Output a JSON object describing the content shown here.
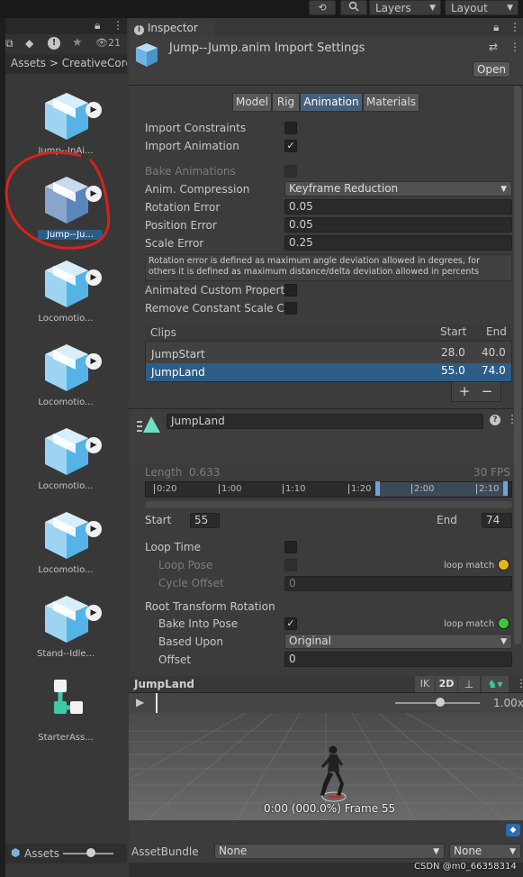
{
  "topbar": {
    "layers_label": "Layers",
    "layout_label": "Layout"
  },
  "project": {
    "toolbar_count": "21",
    "breadcrumb": "Assets > CreativeCore",
    "assets": [
      {
        "label": "Jump--InAi...",
        "selected": false
      },
      {
        "label": "Jump--Ju...",
        "selected": true
      },
      {
        "label": "Locomotio...",
        "selected": false
      },
      {
        "label": "Locomotio...",
        "selected": false
      },
      {
        "label": "Locomotio...",
        "selected": false
      },
      {
        "label": "Locomotio...",
        "selected": false
      },
      {
        "label": "Stand--Idle...",
        "selected": false
      },
      {
        "label": "StarterAss...",
        "selected": false
      }
    ],
    "footer_label": "Assets"
  },
  "inspector": {
    "tab_label": "Inspector",
    "title": "Jump--Jump.anim Import Settings",
    "open_label": "Open",
    "tabs": [
      "Model",
      "Rig",
      "Animation",
      "Materials"
    ],
    "import_constraints_label": "Import Constraints",
    "import_animation_label": "Import Animation",
    "bake_animations_label": "Bake Animations",
    "anim_compression_label": "Anim. Compression",
    "anim_compression_value": "Keyframe Reduction",
    "rotation_error_label": "Rotation Error",
    "rotation_error_value": "0.05",
    "position_error_label": "Position Error",
    "position_error_value": "0.05",
    "scale_error_label": "Scale Error",
    "scale_error_value": "0.25",
    "help_text": "Rotation error is defined as maximum angle deviation allowed in degrees, for others it is defined as maximum distance/delta deviation allowed in percents",
    "animated_custom_label": "Animated Custom Propertie",
    "remove_constant_label": "Remove Constant Scale Cu",
    "clips": {
      "header": "Clips",
      "start_header": "Start",
      "end_header": "End",
      "rows": [
        {
          "name": "JumpStart",
          "start": "28.0",
          "end": "40.0",
          "selected": false
        },
        {
          "name": "JumpLand",
          "start": "55.0",
          "end": "74.0",
          "selected": true
        }
      ],
      "add_label": "+",
      "remove_label": "−"
    },
    "clip_name": "JumpLand",
    "length_label": "Length",
    "length_value": "0.633",
    "fps": "30 FPS",
    "timeline_ticks": [
      "0:20",
      "1:00",
      "1:10",
      "1:20",
      "2:00",
      "2:10"
    ],
    "start_label": "Start",
    "start_value": "55",
    "end_label": "End",
    "end_value": "74",
    "loop_time_label": "Loop Time",
    "loop_pose_label": "Loop Pose",
    "loop_match_label": "loop match",
    "cycle_offset_label": "Cycle Offset",
    "cycle_offset_value": "0",
    "root_rotation_label": "Root Transform Rotation",
    "bake_into_pose_label": "Bake Into Pose",
    "based_upon_label": "Based Upon",
    "based_upon_value": "Original",
    "offset_label": "Offset",
    "offset_value": "0",
    "preview": {
      "name": "JumpLand",
      "ik_label": "IK",
      "twod_label": "2D",
      "speed": "1.00x",
      "frame_text": "0:00 (000.0%) Frame 55"
    },
    "asset_bundle_label": "AssetBundle",
    "asset_bundle_value": "None",
    "asset_bundle_variant": "None",
    "watermark": "CSDN @m0_66358314"
  },
  "colors": {
    "selection": "#2c5d87",
    "loop_match_yellow": "#e6b422",
    "loop_match_green": "#3ec93e",
    "annotation_red": "#d8221c"
  }
}
